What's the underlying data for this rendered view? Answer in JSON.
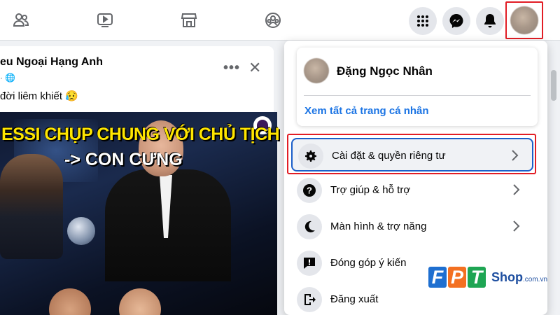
{
  "topbar": {
    "nav_icons": [
      "friends-icon",
      "watch-icon",
      "marketplace-icon",
      "groups-icon"
    ],
    "right_icons": [
      "menu-grid-icon",
      "messenger-icon",
      "notifications-icon"
    ],
    "profile_button": "profile-avatar"
  },
  "post": {
    "page_name": "eu Ngoại Hạng Anh",
    "meta": "· 🌐",
    "text": "đời liêm khiết 😥",
    "more_label": "•••",
    "close_label": "✕",
    "image_caption_line1": "ESSI CHỤP CHUNG VỚI CHỦ TỊCH FIFA",
    "image_caption_line2": "-> CON CƯNG"
  },
  "menu": {
    "profile_name": "Đặng Ngọc Nhân",
    "see_all_profiles": "Xem tất cả trang cá nhân",
    "items": [
      {
        "label": "Cài đặt & quyền riêng tư",
        "icon": "gear-icon",
        "has_chevron": true
      },
      {
        "label": "Trợ giúp & hỗ trợ",
        "icon": "help-icon",
        "has_chevron": true
      },
      {
        "label": "Màn hình & trợ năng",
        "icon": "moon-icon",
        "has_chevron": true
      },
      {
        "label": "Đóng góp ý kiến",
        "icon": "feedback-icon",
        "has_chevron": false
      },
      {
        "label": "Đăng xuất",
        "icon": "logout-icon",
        "has_chevron": false
      }
    ]
  },
  "watermark": {
    "letters": [
      "F",
      "P",
      "T"
    ],
    "shop": "Shop",
    "domain": ".com.vn"
  },
  "colors": {
    "highlight": "#e21d25",
    "link": "#1b74e4",
    "focus_border": "#1b5fc9"
  }
}
